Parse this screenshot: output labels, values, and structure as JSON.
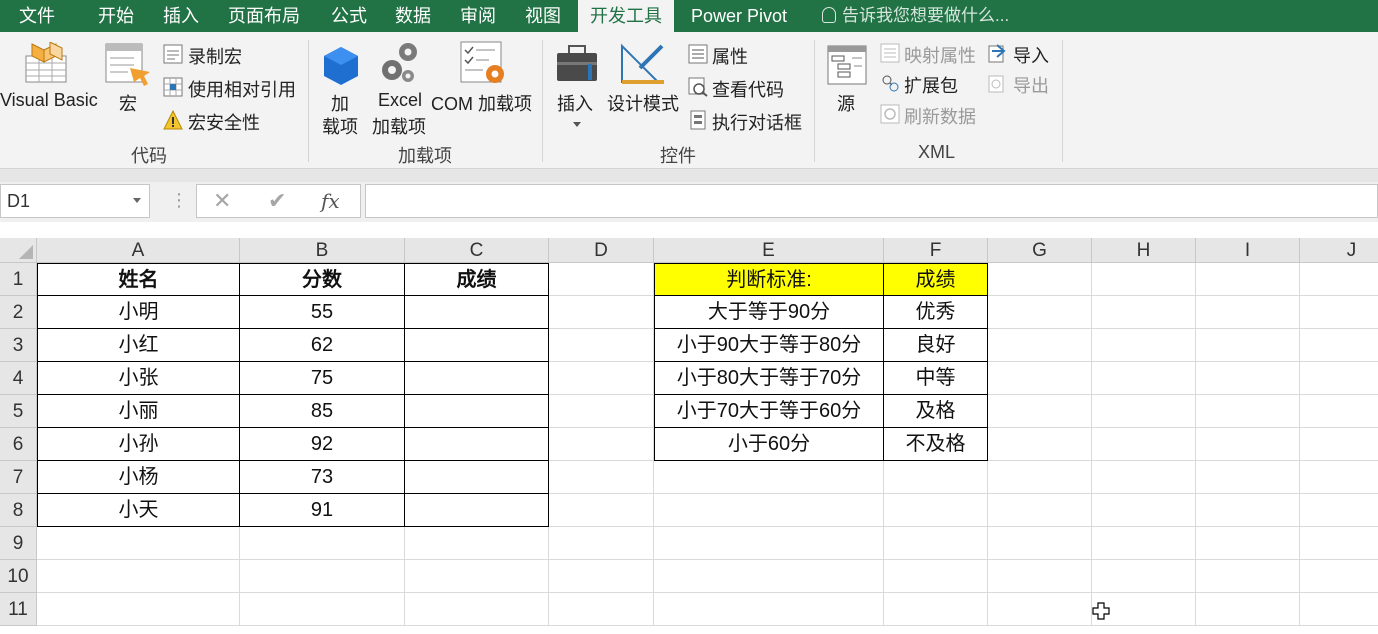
{
  "ribbon_tabs": [
    "文件",
    "开始",
    "插入",
    "页面布局",
    "公式",
    "数据",
    "审阅",
    "视图",
    "开发工具",
    "Power Pivot"
  ],
  "active_tab": "开发工具",
  "tell_me": "告诉我您想要做什么...",
  "groups": {
    "code": {
      "label": "代码",
      "visual_basic": "Visual Basic",
      "macros": "宏",
      "record_macro": "录制宏",
      "use_relative": "使用相对引用",
      "macro_security": "宏安全性"
    },
    "addins": {
      "label": "加载项",
      "addins_line1": "加",
      "addins_line2": "载项",
      "excel_line1": "Excel",
      "excel_line2": "加载项",
      "com": "COM 加载项"
    },
    "controls": {
      "label": "控件",
      "insert": "插入",
      "design_mode": "设计模式",
      "properties": "属性",
      "view_code": "查看代码",
      "run_dialog": "执行对话框"
    },
    "xml": {
      "label": "XML",
      "source": "源",
      "map_properties": "映射属性",
      "expansion_packs": "扩展包",
      "refresh_data": "刷新数据",
      "import": "导入",
      "export": "导出"
    }
  },
  "formula_bar": {
    "name_box": "D1",
    "cancel": "✕",
    "enter": "✔",
    "fx": "fx",
    "value": ""
  },
  "columns": [
    "A",
    "B",
    "C",
    "D",
    "E",
    "F",
    "G",
    "H",
    "I",
    "J"
  ],
  "rows": [
    "1",
    "2",
    "3",
    "4",
    "5",
    "6",
    "7",
    "8",
    "9",
    "10",
    "11"
  ],
  "table_main": {
    "headers": [
      "姓名",
      "分数",
      "成绩"
    ],
    "rows": [
      [
        "小明",
        "55",
        ""
      ],
      [
        "小红",
        "62",
        ""
      ],
      [
        "小张",
        "75",
        ""
      ],
      [
        "小丽",
        "85",
        ""
      ],
      [
        "小孙",
        "92",
        ""
      ],
      [
        "小杨",
        "73",
        ""
      ],
      [
        "小天",
        "91",
        ""
      ]
    ]
  },
  "table_criteria": {
    "headers": [
      "判断标准:",
      "成绩"
    ],
    "rows": [
      [
        "大于等于90分",
        "优秀"
      ],
      [
        "小于90大于等于80分",
        "良好"
      ],
      [
        "小于80大于等于70分",
        "中等"
      ],
      [
        "小于70大于等于60分",
        "及格"
      ],
      [
        "小于60分",
        "不及格"
      ]
    ]
  },
  "colors": {
    "ribbon_green": "#217346",
    "header_yellow": "#ffff00"
  }
}
